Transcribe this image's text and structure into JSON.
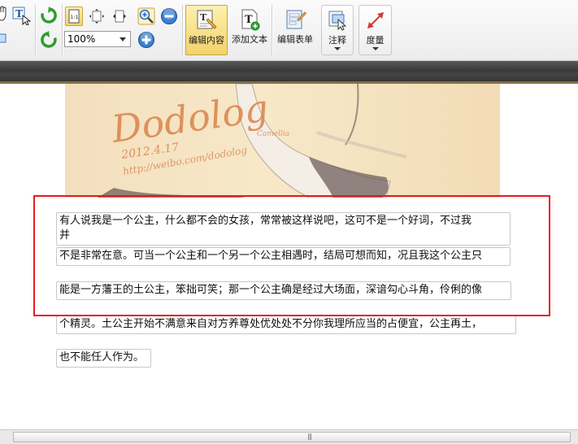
{
  "toolbar": {
    "zoom_value": "100%",
    "actual_size_label": "1:1",
    "buttons": {
      "edit_content": "编辑内容",
      "add_text": "添加文本",
      "edit_form": "编辑表单",
      "annotate": "注释",
      "measure": "度量"
    }
  },
  "document": {
    "image_text": {
      "signature": "Dodolog",
      "date_line": "2012.4.17",
      "url_line": "http://weibo.com/dodolog",
      "small_name": "Camellia"
    },
    "lines": [
      "有人说我是一个公主，什么都不会的女孩，常常被这样说吧，这可不是一个好词，不过我",
      "并",
      "不是非常在意。可当一个公主和一个另一个公主相遇时，结局可想而知，况且我这个公主只",
      "能是一方藩王的土公主，笨拙可笑；那一个公主确是经过大场面，深谙勾心斗角，伶俐的像",
      "个精灵。土公主开始不满意来自对方养尊处优处处不分你我理所应当的占便宜，公主再土，",
      "也不能任人作为。"
    ]
  },
  "colors": {
    "highlight_frame": "#e8191e",
    "active_button": "#f3d36a",
    "dark_bar": "#3a3a3a"
  },
  "scrollbar": {
    "grip": "|||"
  }
}
